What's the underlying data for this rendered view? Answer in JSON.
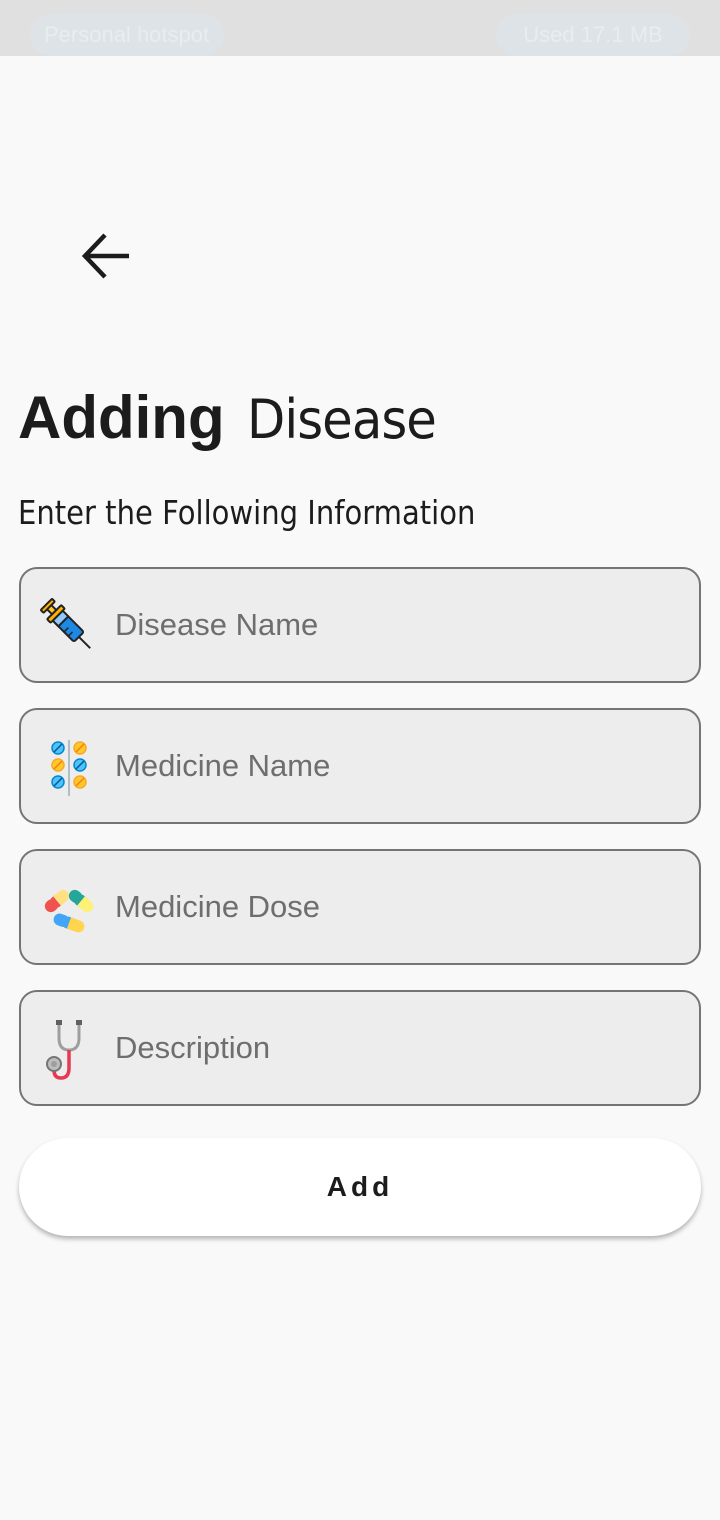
{
  "status_bar": {
    "hotspot_label": "Personal hotspot",
    "usage_label": "Used  17.1 MB"
  },
  "header": {
    "back_icon": "arrow-left-icon"
  },
  "title": {
    "bold": "Adding",
    "light": "Disease"
  },
  "subtitle": "Enter the Following Information",
  "fields": [
    {
      "icon": "syringe-icon",
      "placeholder": "Disease Name",
      "value": ""
    },
    {
      "icon": "pills-icon",
      "placeholder": "Medicine Name",
      "value": ""
    },
    {
      "icon": "capsules-icon",
      "placeholder": "Medicine Dose",
      "value": ""
    },
    {
      "icon": "stethoscope-icon",
      "placeholder": "Description",
      "value": ""
    }
  ],
  "add_button": {
    "label": "Add"
  },
  "colors": {
    "background": "#f9f9f9",
    "field_fill": "#ededed",
    "field_border": "#757575",
    "text": "#1c1c1c",
    "placeholder": "#6e6e6e",
    "button": "#ffffff"
  }
}
